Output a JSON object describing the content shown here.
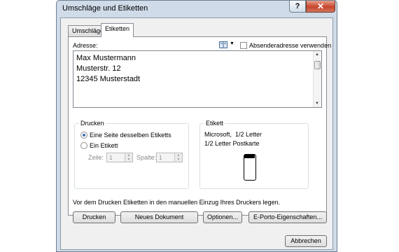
{
  "window": {
    "title": "Umschläge und Etiketten",
    "help_label": "?",
    "close_label": "✕"
  },
  "tabs": [
    {
      "label": "Umschläge",
      "active": false
    },
    {
      "label": "Etiketten",
      "active": true
    }
  ],
  "address": {
    "label": "Adresse:",
    "value": "Max Mustermann\nMusterstr. 12\n12345 Musterstadt",
    "use_sender_label": "Absenderadresse verwenden",
    "use_sender_checked": false
  },
  "print_group": {
    "title": "Drucken",
    "option_full_page": "Eine Seite desselben Etiketts",
    "option_single": "Ein Etikett",
    "selected": "full_page",
    "row_label": "Zeile:",
    "row_value": "1",
    "column_label": "Spalte:",
    "column_value": "1"
  },
  "label_group": {
    "title": "Etikett",
    "description": "Microsoft,  1/2 Letter\n1/2 Letter Postkarte"
  },
  "note": "Vor dem Drucken Etiketten in den manuellen Einzug Ihres Druckers legen.",
  "buttons": {
    "print": "Drucken",
    "new_document": "Neues Dokument",
    "options": "Optionen...",
    "e_porto": "E-Porto-Eigenschaften...",
    "cancel": "Abbrechen"
  },
  "icons": {
    "address_book": "address-book-icon",
    "dropdown": "chevron-down-icon"
  }
}
